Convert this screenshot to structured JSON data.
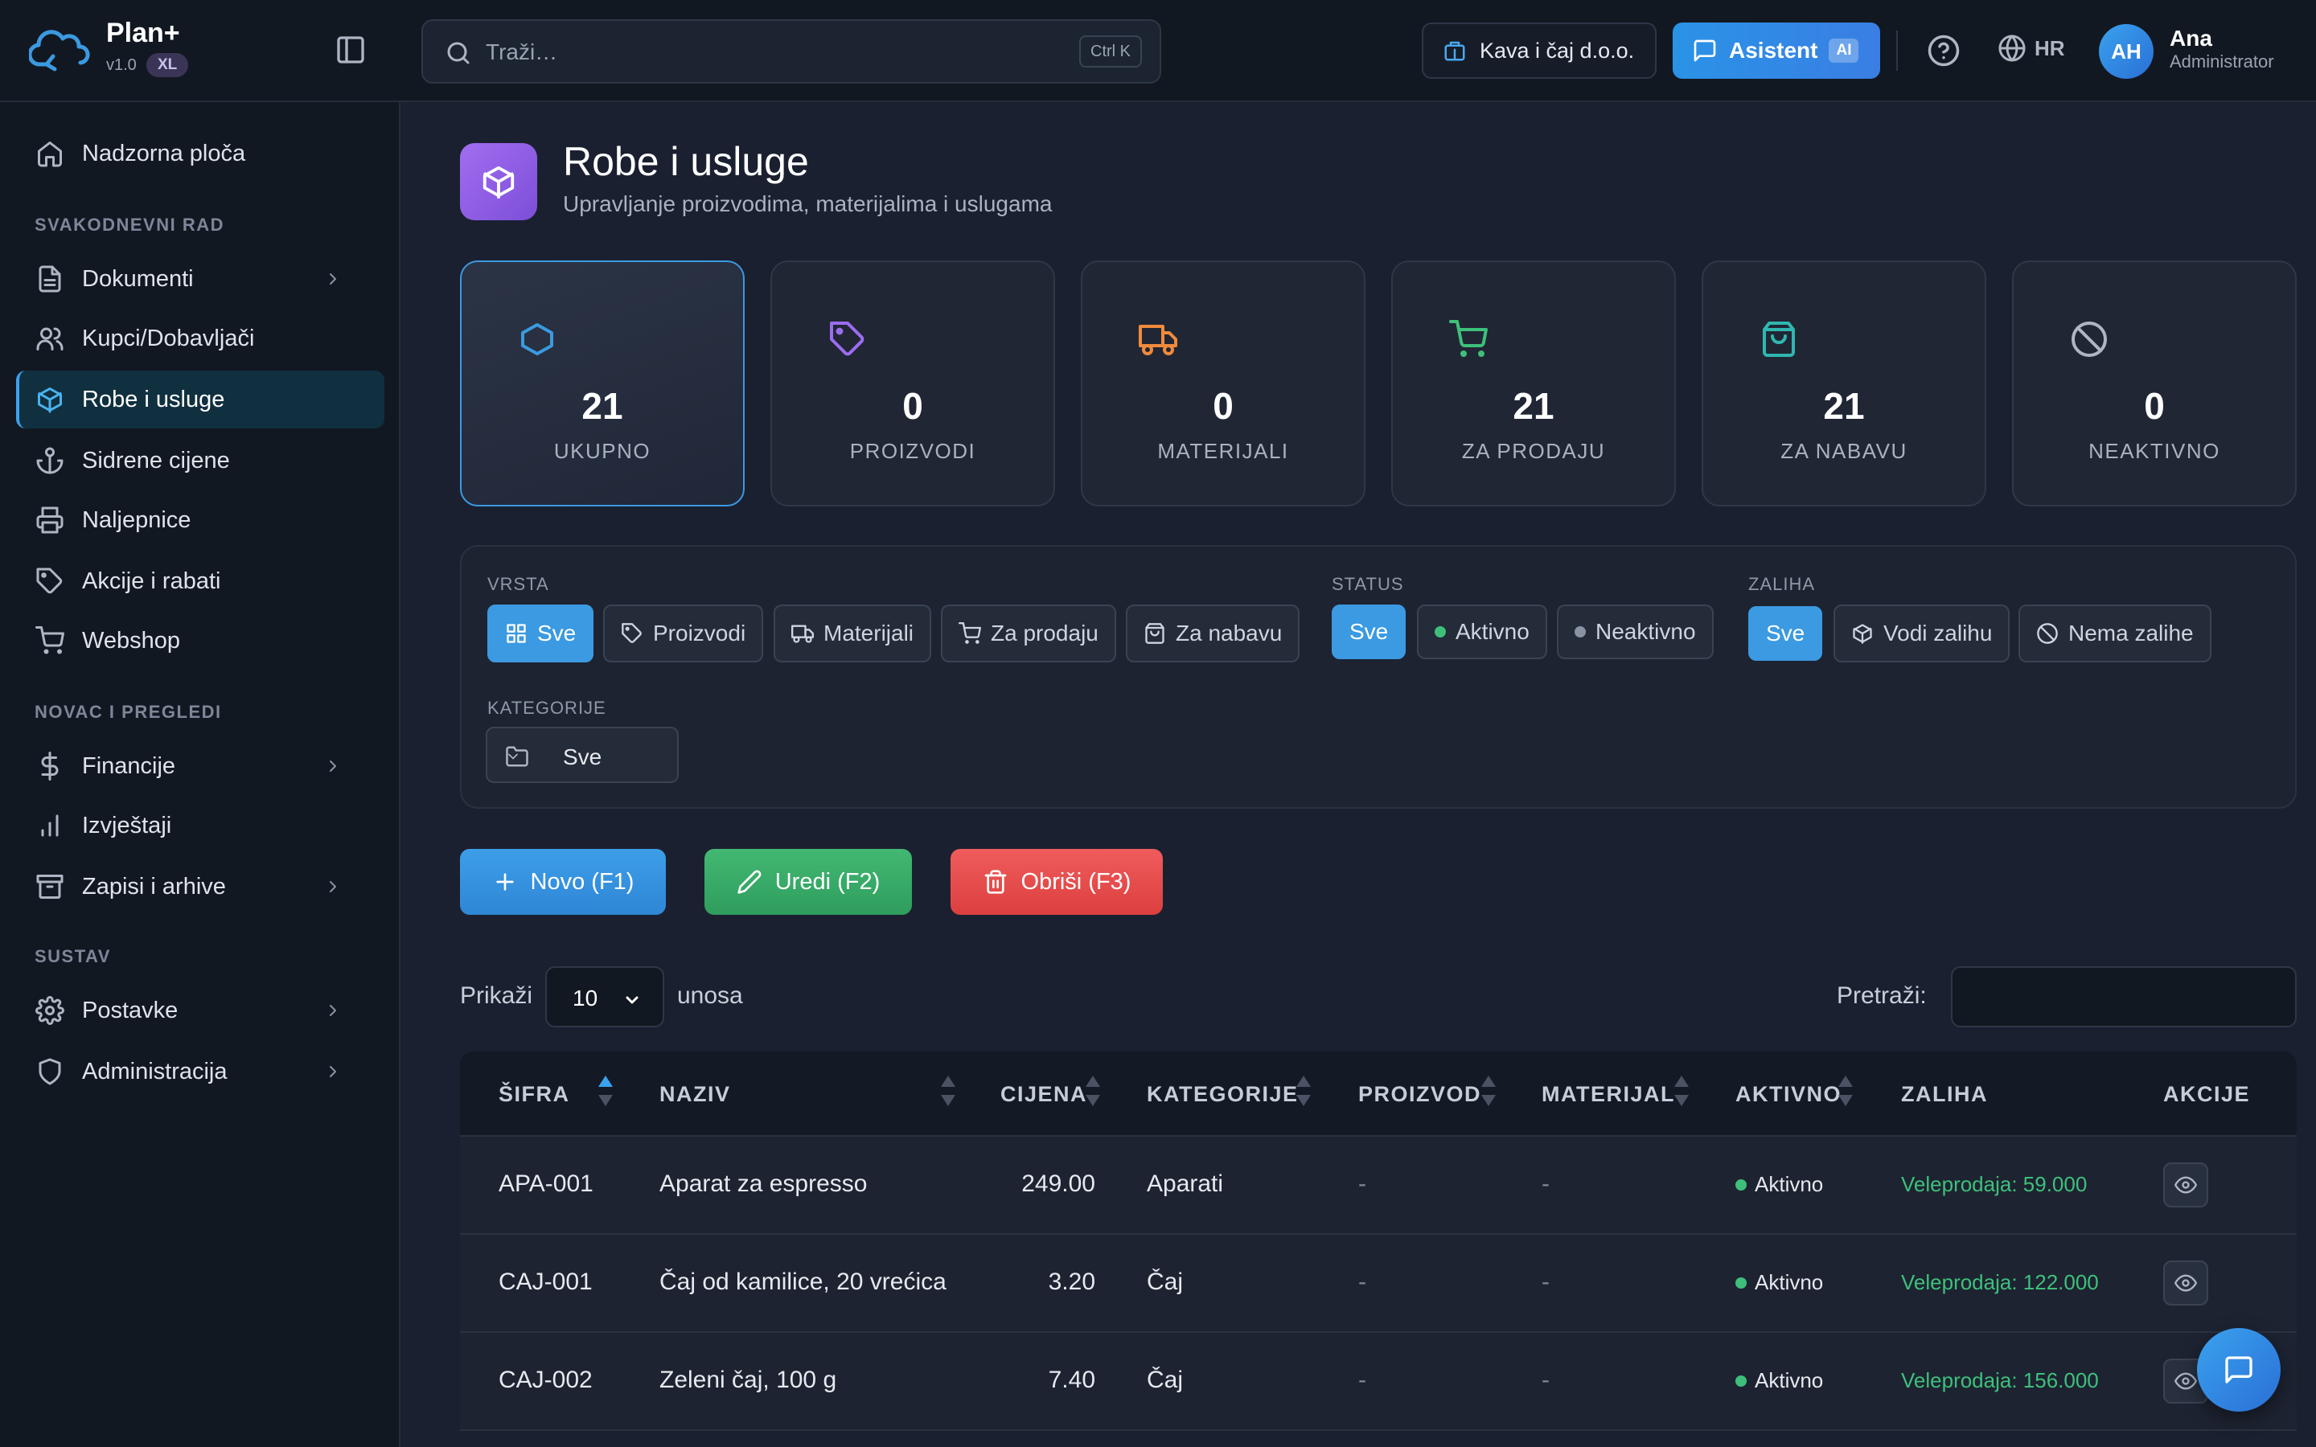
{
  "app": {
    "name": "Plan+",
    "version": "v1.0",
    "badge": "XL"
  },
  "search": {
    "placeholder": "Traži…",
    "shortcut": "Ctrl K"
  },
  "header": {
    "company": "Kava i čaj d.o.o.",
    "assistant_label": "Asistent",
    "assistant_tag": "AI",
    "language": "HR",
    "user": {
      "initials": "AH",
      "name": "Ana",
      "role": "Administrator"
    }
  },
  "sidebar": {
    "dashboard": "Nadzorna ploča",
    "sections": [
      "SVAKODNEVNI RAD",
      "NOVAC I PREGLEDI",
      "SUSTAV"
    ],
    "items": [
      {
        "label": "Dokumenti",
        "icon": "document-icon",
        "chevron": true
      },
      {
        "label": "Kupci/Dobavljači",
        "icon": "users-icon",
        "chevron": false
      },
      {
        "label": "Robe i usluge",
        "icon": "box-icon",
        "chevron": false,
        "active": true
      },
      {
        "label": "Sidrene cijene",
        "icon": "anchor-icon",
        "chevron": false
      },
      {
        "label": "Naljepnice",
        "icon": "printer-icon",
        "chevron": false
      },
      {
        "label": "Akcije i rabati",
        "icon": "tag-icon",
        "chevron": false
      },
      {
        "label": "Webshop",
        "icon": "cart-icon",
        "chevron": false
      },
      {
        "label": "Financije",
        "icon": "dollar-icon",
        "chevron": true
      },
      {
        "label": "Izvještaji",
        "icon": "bar-chart-icon",
        "chevron": false
      },
      {
        "label": "Zapisi i arhive",
        "icon": "archive-icon",
        "chevron": true
      },
      {
        "label": "Postavke",
        "icon": "gear-icon",
        "chevron": true
      },
      {
        "label": "Administracija",
        "icon": "shield-icon",
        "chevron": true
      }
    ]
  },
  "page": {
    "title": "Robe i usluge",
    "subtitle": "Upravljanje proizvodima, materijalima i uslugama"
  },
  "stats": [
    {
      "value": "21",
      "label": "UKUPNO",
      "icon": "box-icon",
      "color": "#3b9ae1",
      "active": true
    },
    {
      "value": "0",
      "label": "PROIZVODI",
      "icon": "tag-icon",
      "color": "#9b6df0"
    },
    {
      "value": "0",
      "label": "MATERIJALI",
      "icon": "truck-icon",
      "color": "#f08a3c"
    },
    {
      "value": "21",
      "label": "ZA PRODAJU",
      "icon": "cart-icon",
      "color": "#3ec07a"
    },
    {
      "value": "21",
      "label": "ZA NABAVU",
      "icon": "bag-icon",
      "color": "#2fb7b0"
    },
    {
      "value": "0",
      "label": "NEAKTIVNO",
      "icon": "ban-icon",
      "color": "#aeb6c4"
    }
  ],
  "filters": {
    "type_label": "VRSTA",
    "type_options": [
      "Sve",
      "Proizvodi",
      "Materijali",
      "Za prodaju",
      "Za nabavu"
    ],
    "status_label": "STATUS",
    "status_options": [
      "Sve",
      "Aktivno",
      "Neaktivno"
    ],
    "stock_label": "ZALIHA",
    "stock_options": [
      "Sve",
      "Vodi zalihu",
      "Nema zalihe"
    ],
    "category_label": "KATEGORIJE",
    "category_value": "Sve"
  },
  "actions": {
    "new": "Novo (F1)",
    "edit": "Uredi (F2)",
    "delete": "Obriši (F3)"
  },
  "table": {
    "show_label": "Prikaži",
    "page_size": "10",
    "entries_label": "unosa",
    "search_label": "Pretraži:",
    "columns": [
      "ŠIFRA",
      "NAZIV",
      "CIJENA",
      "KATEGORIJE",
      "PROIZVOD",
      "MATERIJAL",
      "AKTIVNO",
      "ZALIHA",
      "AKCIJE"
    ],
    "rows": [
      {
        "code": "APA-001",
        "name": "Aparat za espresso",
        "price": "249.00",
        "category": "Aparati",
        "product": "-",
        "material": "-",
        "active": "Aktivno",
        "stock": "Veleprodaja: 59.000"
      },
      {
        "code": "CAJ-001",
        "name": "Čaj od kamilice, 20 vrećica",
        "price": "3.20",
        "category": "Čaj",
        "product": "-",
        "material": "-",
        "active": "Aktivno",
        "stock": "Veleprodaja: 122.000"
      },
      {
        "code": "CAJ-002",
        "name": "Zeleni čaj, 100 g",
        "price": "7.40",
        "category": "Čaj",
        "product": "-",
        "material": "-",
        "active": "Aktivno",
        "stock": "Veleprodaja: 156.000"
      }
    ]
  },
  "colors": {
    "accent": "#3b9ae1",
    "success": "#3ec07a",
    "danger": "#e84a4a",
    "purple": "#9b6df0"
  }
}
